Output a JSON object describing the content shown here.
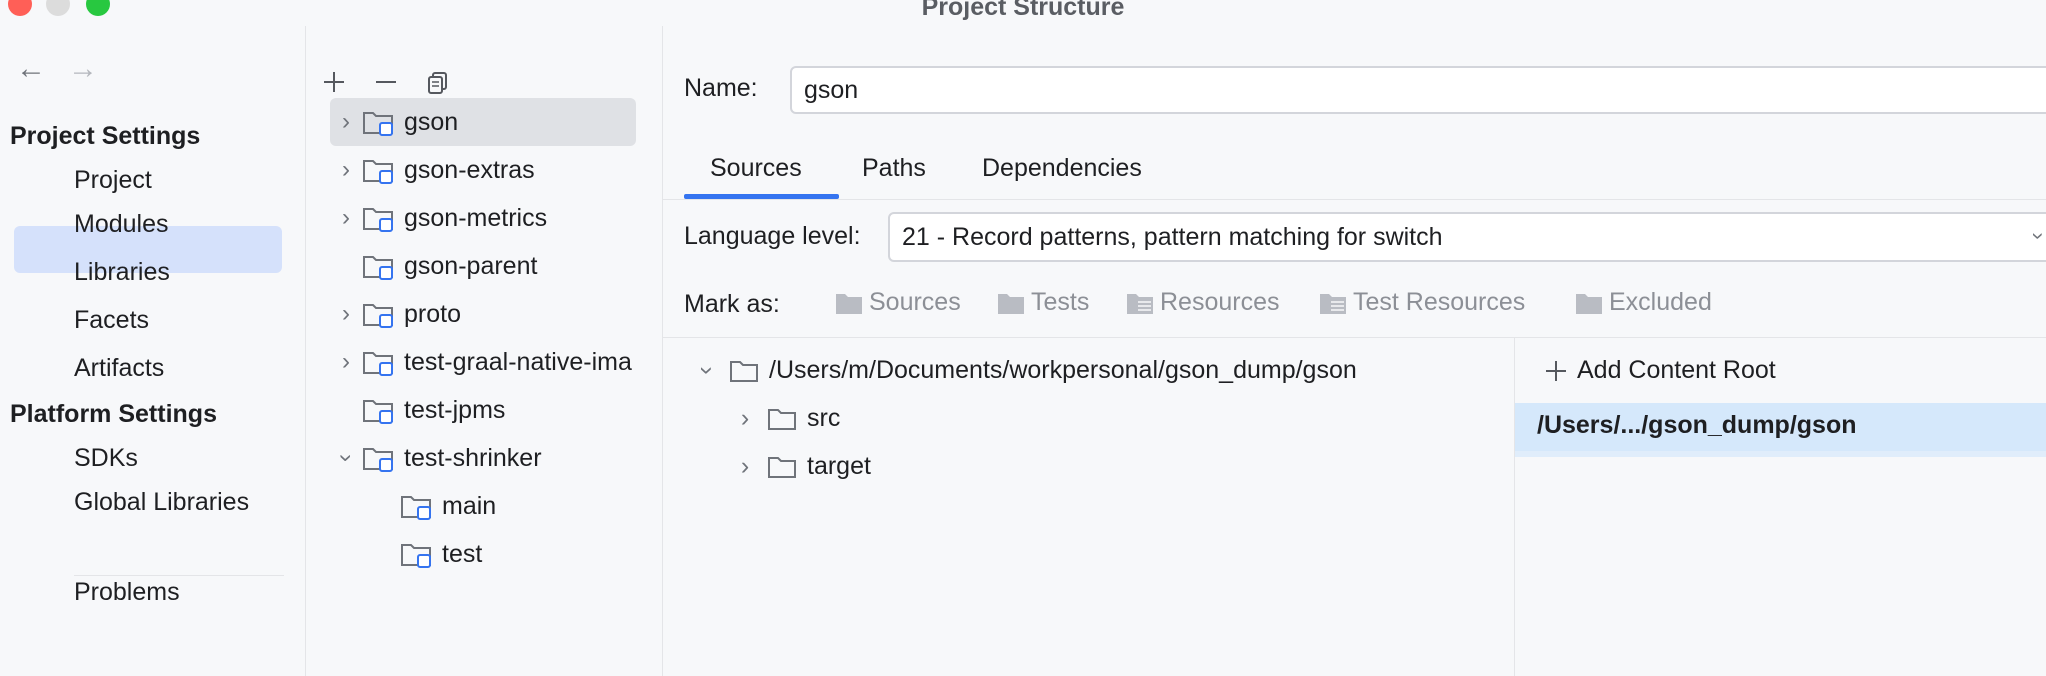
{
  "window": {
    "title": "Project Structure"
  },
  "left_nav": {
    "back_icon": "arrow-left-icon",
    "forward_icon": "arrow-right-icon",
    "project_settings_heading": "Project Settings",
    "project_settings_items": [
      "Project",
      "Modules",
      "Libraries",
      "Facets",
      "Artifacts"
    ],
    "selected_item": "Modules",
    "platform_settings_heading": "Platform Settings",
    "platform_settings_items": [
      "SDKs",
      "Global Libraries"
    ],
    "problems_label": "Problems"
  },
  "modules_panel": {
    "toolbar": [
      "add-icon",
      "remove-icon",
      "copy-icon"
    ],
    "tree": [
      {
        "label": "gson",
        "expandable": true,
        "expanded": false,
        "level": 0,
        "selected": true
      },
      {
        "label": "gson-extras",
        "expandable": true,
        "expanded": false,
        "level": 0
      },
      {
        "label": "gson-metrics",
        "expandable": true,
        "expanded": false,
        "level": 0
      },
      {
        "label": "gson-parent",
        "expandable": false,
        "level": 0
      },
      {
        "label": "proto",
        "expandable": true,
        "expanded": false,
        "level": 0
      },
      {
        "label": "test-graal-native-ima",
        "expandable": true,
        "expanded": false,
        "level": 0
      },
      {
        "label": "test-jpms",
        "expandable": false,
        "level": 0
      },
      {
        "label": "test-shrinker",
        "expandable": true,
        "expanded": true,
        "level": 0
      },
      {
        "label": "main",
        "expandable": false,
        "level": 1
      },
      {
        "label": "test",
        "expandable": false,
        "level": 1
      }
    ]
  },
  "module_detail": {
    "name_label": "Name:",
    "name_value": "gson",
    "tabs": [
      "Sources",
      "Paths",
      "Dependencies"
    ],
    "active_tab": "Sources",
    "language_level_label": "Language level:",
    "language_level_value": "21 - Record patterns, pattern matching for switch",
    "mark_as_label": "Mark as:",
    "mark_as_options": [
      "Sources",
      "Tests",
      "Resources",
      "Test Resources",
      "Excluded"
    ],
    "content_tree": {
      "root": "/Users/m/Documents/workpersonal/gson_dump/gson",
      "children": [
        "src",
        "target"
      ]
    },
    "add_content_root_label": "Add Content Root",
    "content_root_entry": "/Users/.../gson_dump/gson"
  },
  "colors": {
    "accent": "#3574f0",
    "selection": "#d5e1fb",
    "close": "#ff5f57",
    "zoom": "#28c840"
  }
}
